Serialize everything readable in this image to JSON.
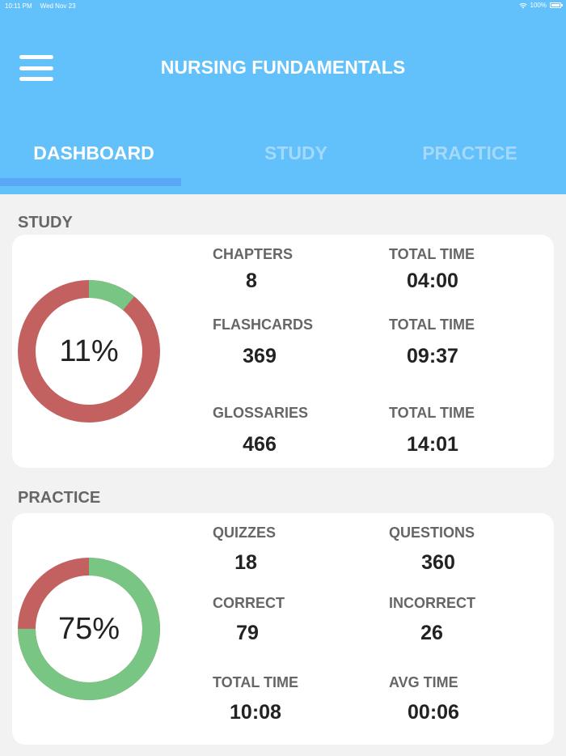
{
  "status_bar": {
    "time": "10:11 PM",
    "date": "Wed Nov 23",
    "battery": "100%"
  },
  "header": {
    "title": "NURSING FUNDAMENTALS"
  },
  "tabs": [
    {
      "label": "DASHBOARD",
      "active": true
    },
    {
      "label": "STUDY",
      "active": false
    },
    {
      "label": "PRACTICE",
      "active": false
    }
  ],
  "colors": {
    "header_bg": "#62c0fb",
    "tab_indicator": "#5aa8f5",
    "ring_green": "#78c584",
    "ring_red": "#c36161"
  },
  "study": {
    "section_label": "STUDY",
    "percent_label": "11%",
    "progress": 0.11,
    "stats": [
      {
        "label": "CHAPTERS",
        "value": "8"
      },
      {
        "label": "TOTAL TIME",
        "value": "04:00"
      },
      {
        "label": "FLASHCARDS",
        "value": "369"
      },
      {
        "label": "TOTAL TIME",
        "value": "09:37"
      },
      {
        "label": "GLOSSARIES",
        "value": "466"
      },
      {
        "label": "TOTAL TIME",
        "value": "14:01"
      }
    ]
  },
  "practice": {
    "section_label": "PRACTICE",
    "percent_label": "75%",
    "progress": 0.75,
    "stats": [
      {
        "label": "QUIZZES",
        "value": "18"
      },
      {
        "label": "QUESTIONS",
        "value": "360"
      },
      {
        "label": "CORRECT",
        "value": "79"
      },
      {
        "label": "INCORRECT",
        "value": "26"
      },
      {
        "label": "TOTAL TIME",
        "value": "10:08"
      },
      {
        "label": "AVG TIME",
        "value": "00:06"
      }
    ]
  }
}
